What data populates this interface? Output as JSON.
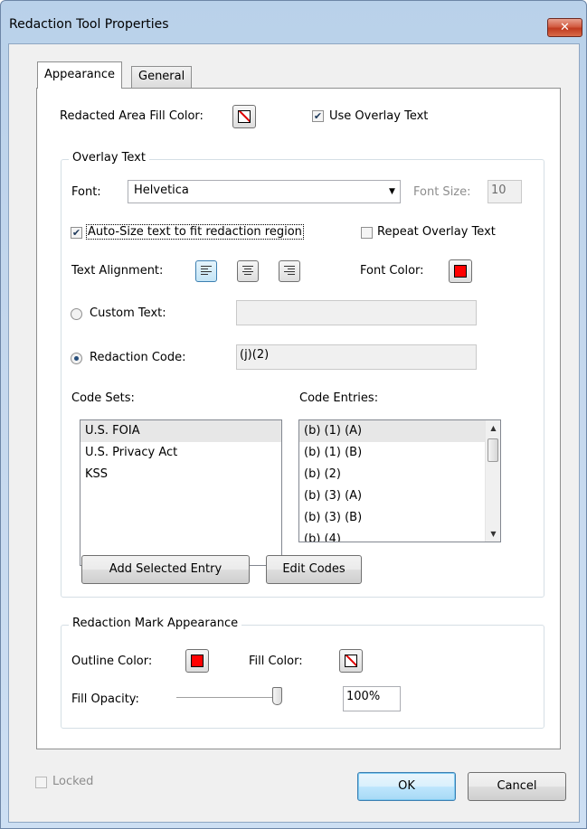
{
  "window": {
    "title": "Redaction Tool Properties",
    "close_glyph": "✕"
  },
  "tabs": [
    {
      "label": "Appearance"
    },
    {
      "label": "General"
    }
  ],
  "appearance": {
    "fill_color_label": "Redacted Area Fill Color:",
    "fill_color": "none",
    "use_overlay_label": "Use Overlay Text",
    "use_overlay_checked": true,
    "overlay_group": {
      "title": "Overlay Text",
      "font_label": "Font:",
      "font_value": "Helvetica",
      "font_size_label": "Font Size:",
      "font_size_value": "10",
      "autosize_label": "Auto-Size text to fit redaction region",
      "autosize_checked": true,
      "repeat_label": "Repeat Overlay Text",
      "repeat_checked": false,
      "alignment_label": "Text Alignment:",
      "font_color_label": "Font Color:",
      "font_color": "#ff0000",
      "custom_text_label": "Custom Text:",
      "custom_text_value": "",
      "redaction_code_label": "Redaction Code:",
      "redaction_code_value": "(j)(2)",
      "selected_text_mode": "redaction_code",
      "code_sets_label": "Code Sets:",
      "code_sets": [
        "U.S. FOIA",
        "U.S. Privacy Act",
        "KSS"
      ],
      "code_entries_label": "Code Entries:",
      "code_entries": [
        "(b) (1) (A)",
        "(b) (1) (B)",
        "(b) (2)",
        "(b) (3) (A)",
        "(b) (3) (B)",
        "(b) (4)"
      ],
      "add_entry_label": "Add Selected Entry",
      "edit_codes_label": "Edit Codes"
    },
    "mark_group": {
      "title": "Redaction Mark Appearance",
      "outline_color_label": "Outline Color:",
      "outline_color": "#ff0000",
      "fill_color_label": "Fill Color:",
      "fill_opacity_label": "Fill Opacity:",
      "fill_opacity_value": "100%",
      "fill_opacity_fraction": 1.0
    }
  },
  "footer": {
    "locked_label": "Locked",
    "ok_label": "OK",
    "cancel_label": "Cancel"
  }
}
